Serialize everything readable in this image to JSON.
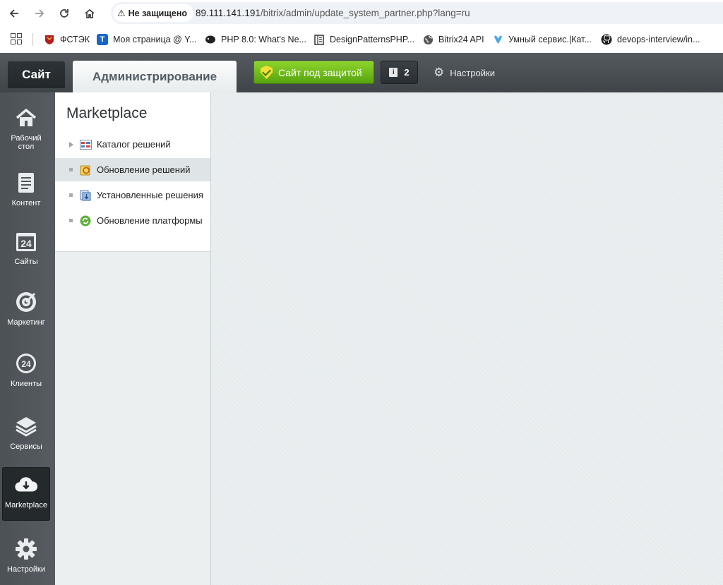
{
  "browser": {
    "back_icon": "arrow-left-icon",
    "forward_icon": "arrow-right-icon",
    "reload_icon": "reload-icon",
    "home_icon": "home-icon",
    "security_label": "Не защищено",
    "url_host": "89.111.141.191",
    "url_path": "/bitrix/admin/update_system_partner.php?lang=ru"
  },
  "bookmarks": [
    {
      "label": "ФСТЭК",
      "icon": "fstek-emblem-icon"
    },
    {
      "label": "Моя страница @ Y...",
      "icon": "t-logo-icon"
    },
    {
      "label": "PHP 8.0: What's Ne...",
      "icon": "php-elephant-icon"
    },
    {
      "label": "DesignPatternsPHP...",
      "icon": "book-icon"
    },
    {
      "label": "Bitrix24 API",
      "icon": "globe-icon"
    },
    {
      "label": "Умный сервис.|Кат...",
      "icon": "heart-logo-icon"
    },
    {
      "label": "devops-interview/in...",
      "icon": "github-icon"
    }
  ],
  "admin_panel": {
    "site_tab": "Сайт",
    "admin_tab": "Администрирование",
    "protect_button": "Сайт под защитой",
    "notifications_count": "2",
    "info_glyph": "i",
    "settings_label": "Настройки"
  },
  "rail": [
    {
      "label": "Рабочий стол",
      "icon": "house-icon"
    },
    {
      "label": "Контент",
      "icon": "document-icon"
    },
    {
      "label": "Сайты",
      "icon": "calendar-24-icon"
    },
    {
      "label": "Маркетинг",
      "icon": "target-icon"
    },
    {
      "label": "Клиенты",
      "icon": "bitrix24-icon"
    },
    {
      "label": "Сервисы",
      "icon": "layers-icon"
    },
    {
      "label": "Marketplace",
      "icon": "cloud-download-icon",
      "active": true
    },
    {
      "label": "Настройки",
      "icon": "gear-icon"
    }
  ],
  "calendar_glyph": "24",
  "clients_glyph": "24",
  "menu": {
    "title": "Marketplace",
    "items": [
      {
        "label": "Каталог решений",
        "marker": "arrow",
        "icon": "catalog-icon"
      },
      {
        "label": "Обновление решений",
        "marker": "dot",
        "icon": "update-solutions-icon",
        "active": true
      },
      {
        "label": "Установленные решения",
        "marker": "dot",
        "icon": "installed-solutions-icon"
      },
      {
        "label": "Обновление платформы",
        "marker": "dot",
        "icon": "platform-update-icon"
      }
    ]
  },
  "colors": {
    "rail_bg": "#50565b",
    "protect_green": "#6cbb16",
    "workarea_bg": "#e6ebed"
  }
}
